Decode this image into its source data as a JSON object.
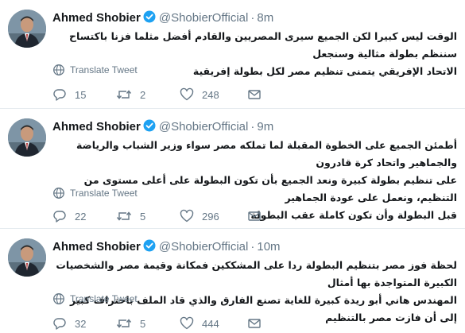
{
  "colors": {
    "verified": "#1da1f2",
    "muted": "#657786",
    "text": "#14171a",
    "divider": "#e6ecf0"
  },
  "tweets": [
    {
      "name": "Ahmed Shobier",
      "handle": "@ShobierOfficial",
      "separator": "·",
      "time": "8m",
      "lines": [
        "الوقت ليس كبيرا لكن الجميع سيرى المصريين والقادم أفضل مثلما فزنا باكتساح سننظم بطولة مثالية وسنجعل",
        "الاتحاد الإفريقي يتمنى تنظيم مصر لكل بطولة إفريقية"
      ],
      "translate_label": "Translate Tweet",
      "replies": "15",
      "retweets": "2",
      "likes": "248"
    },
    {
      "name": "Ahmed Shobier",
      "handle": "@ShobierOfficial",
      "separator": "·",
      "time": "9m",
      "lines": [
        "أطمئن الجميع على الخطوة المقبلة لما تملكه مصر سواء وزير الشباب والرياضة والجماهير واتحاد كرة قادرون",
        "على تنظيم بطولة كبيرة ونعد الجميع بأن تكون البطولة على أعلى مستوى من التنظيم، ونعمل على عودة الجماهير",
        "قبل البطولة وأن تكون كاملة عقب البطولة"
      ],
      "translate_label": "Translate Tweet",
      "replies": "22",
      "retweets": "5",
      "likes": "296"
    },
    {
      "name": "Ahmed Shobier",
      "handle": "@ShobierOfficial",
      "separator": "·",
      "time": "10m",
      "lines": [
        "لحظة فوز مصر بتنظيم البطولة ردا على المشككين فمكانة وقيمة مصر والشخصيات الكبيرة المتواجدة بها أمثال",
        "المهندس هاني أبو ريدة كبيرة للغاية تصنع الفارق والذي قاد الملف باحتراف كبير إلى أن فازت مصر بالتنظيم"
      ],
      "translate_label": "Translate Tweet",
      "replies": "32",
      "retweets": "5",
      "likes": "444"
    }
  ]
}
